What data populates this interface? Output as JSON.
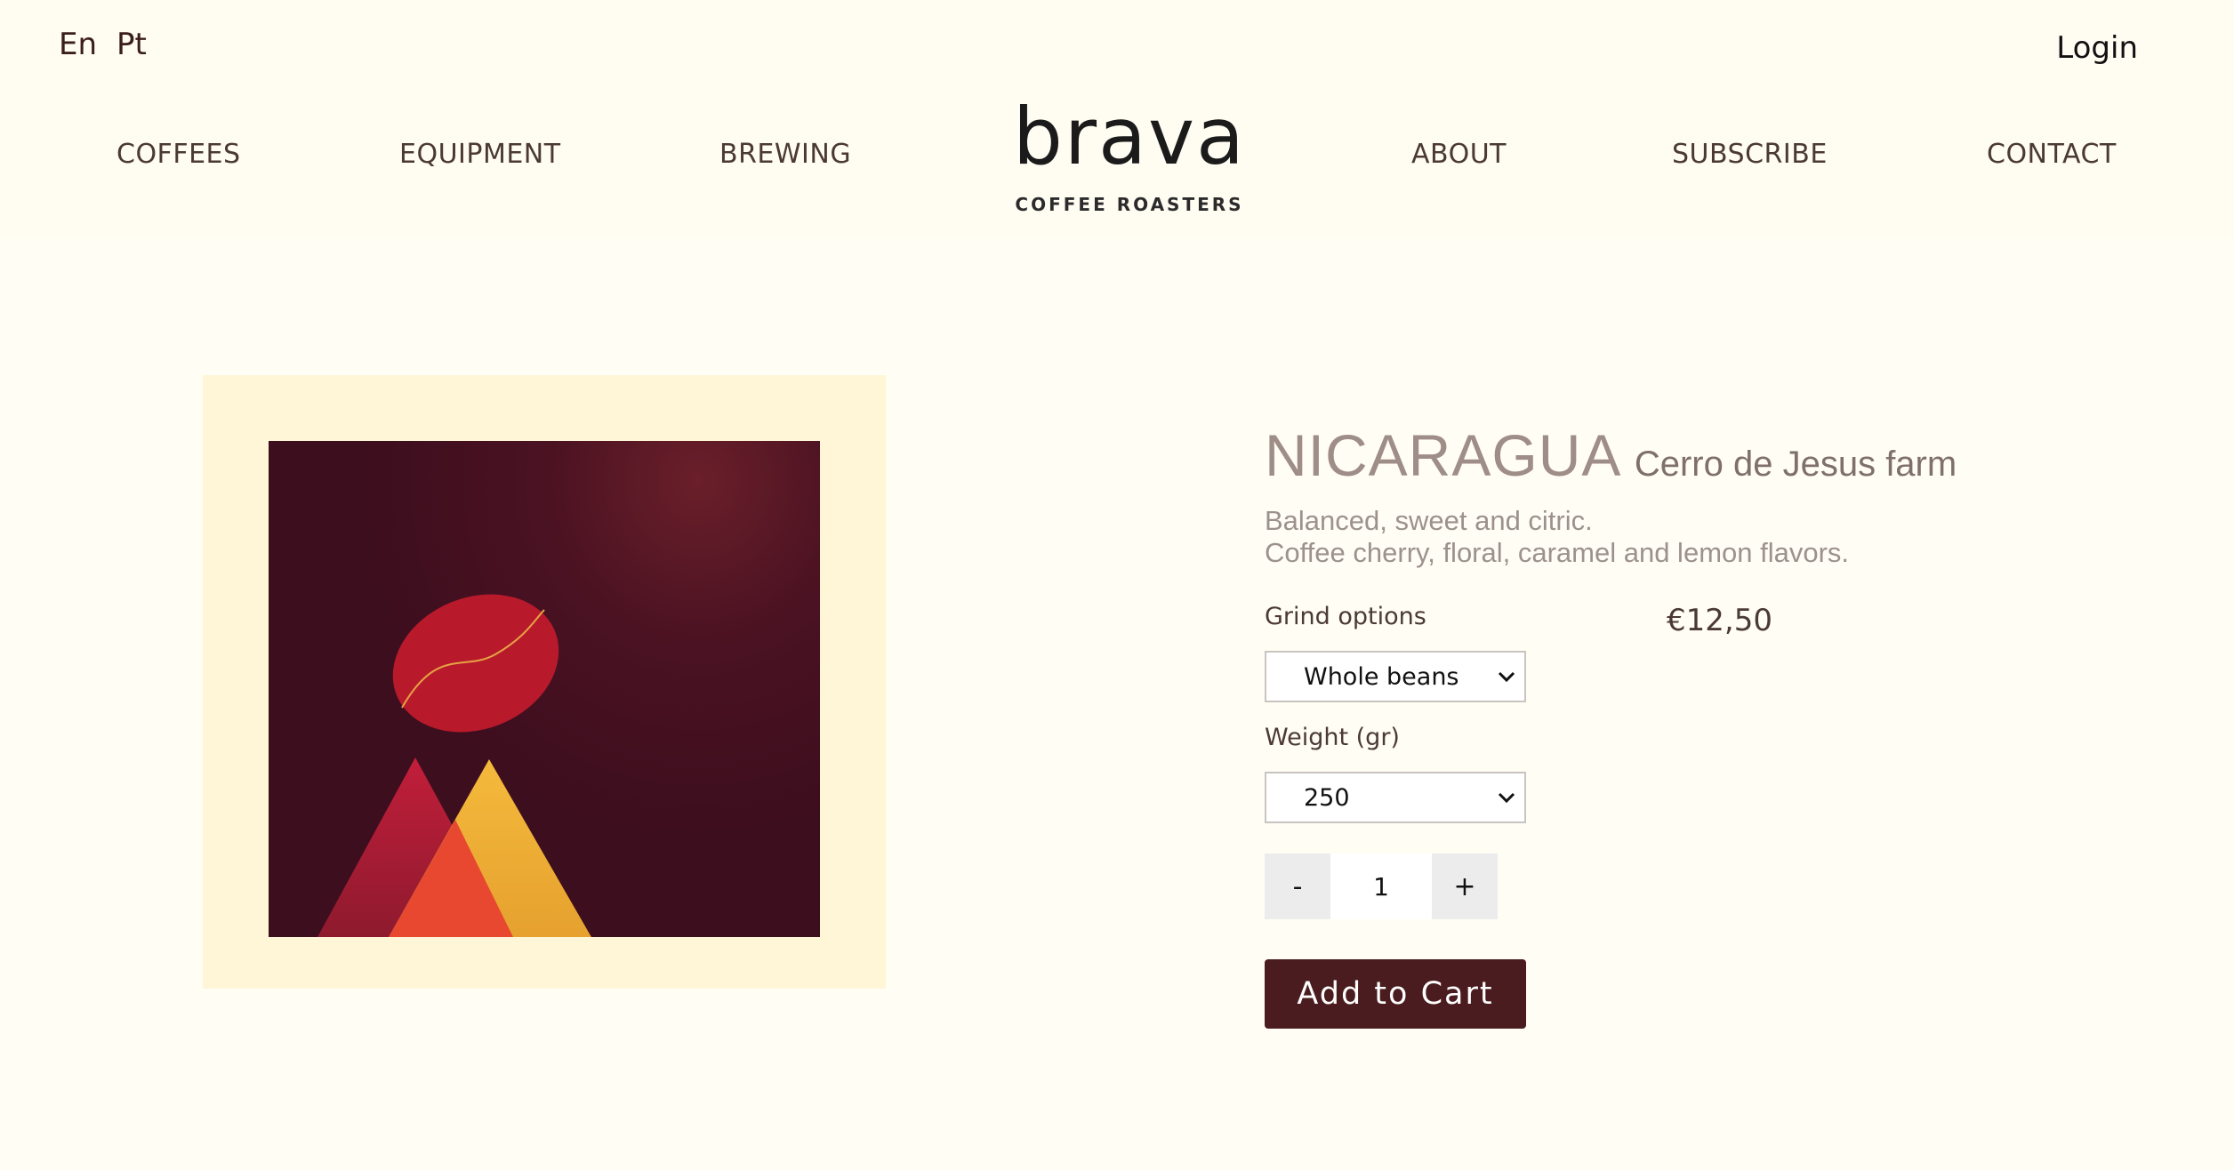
{
  "header": {
    "languages": [
      "En",
      "Pt"
    ],
    "login_label": "Login",
    "nav": {
      "coffees": "COFFEES",
      "equipment": "EQUIPMENT",
      "brewing": "BREWING",
      "about": "ABOUT",
      "subscribe": "SUBSCRIBE",
      "contact": "CONTACT"
    },
    "logo": {
      "word": "brava",
      "subtitle": "COFFEE ROASTERS"
    }
  },
  "product": {
    "name": "NICARAGUA",
    "origin": "Cerro de Jesus farm",
    "description_line1": "Balanced, sweet and citric.",
    "description_line2": "Coffee cherry, floral, caramel and lemon flavors.",
    "price": "€12,50",
    "grind_label": "Grind options",
    "grind_selected": "Whole beans",
    "weight_label": "Weight (gr)",
    "weight_selected": "250",
    "quantity": {
      "minus": "-",
      "value": "1",
      "plus": "+"
    },
    "add_to_cart": "Add to Cart"
  },
  "colors": {
    "background": "#fffdf4",
    "brand_dark": "#4b1c1f",
    "art_background": "#3d0e1e",
    "bean_red": "#b81a2c",
    "mountain_yellow": "#f0b138",
    "mountain_orange": "#e84830"
  }
}
